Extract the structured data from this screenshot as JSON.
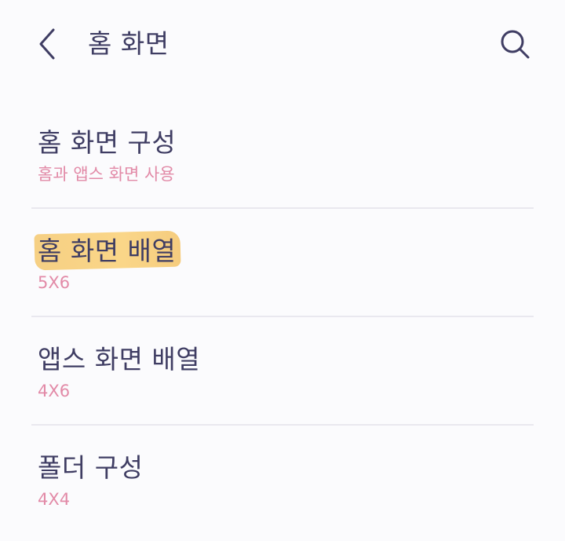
{
  "header": {
    "title": "홈 화면",
    "back_icon": "chevron-left-icon",
    "search_icon": "search-icon"
  },
  "items": [
    {
      "label": "홈 화면 구성",
      "sub": "홈과 앱스 화면 사용"
    },
    {
      "label": "홈 화면 배열",
      "sub": "5X6",
      "highlighted": true
    },
    {
      "label": "앱스 화면 배열",
      "sub": "4X6"
    },
    {
      "label": "폴더 구성",
      "sub": "4X4"
    }
  ],
  "colors": {
    "text_primary": "#3f3d63",
    "text_secondary": "#e28aa7",
    "highlight": "#f5c86e",
    "background": "#fbfbfd"
  }
}
